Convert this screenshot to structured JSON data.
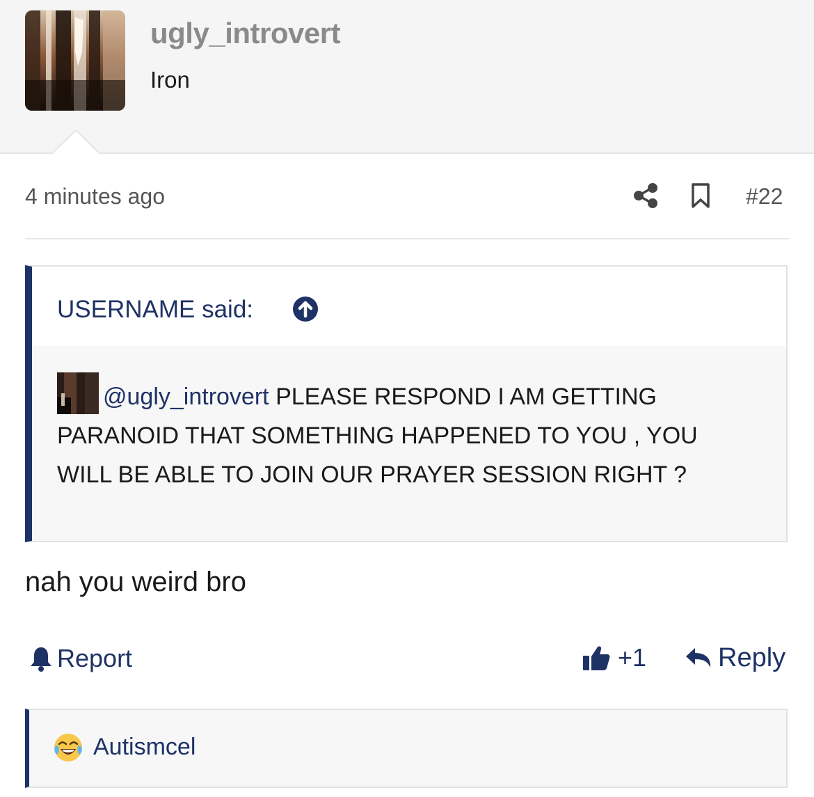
{
  "colors": {
    "accent": "#1f3266",
    "header_bg": "#f5f5f5",
    "quote_bg": "#f7f7f7",
    "username": "#8a8a8a",
    "meta_text": "#555555"
  },
  "author": {
    "username": "ugly_introvert",
    "title": "Iron",
    "avatar_icon": "avatar-image"
  },
  "post_meta": {
    "time": "4 minutes ago",
    "share_icon": "share-icon",
    "bookmark_icon": "bookmark-icon",
    "number": "#22"
  },
  "quote": {
    "author_label": "USERNAME said:",
    "jump_icon": "arrow-up-circle-icon",
    "mention": "@ugly_introvert",
    "text": " PLEASE RESPOND I AM GETTING PARANOID THAT SOMETHING HAPPENED TO YOU , YOU WILL BE ABLE TO JOIN OUR PRAYER SESSION RIGHT ?"
  },
  "body": "nah you weird bro",
  "actions": {
    "report_label": "Report",
    "report_icon": "bell-icon",
    "like_count": "+1",
    "like_icon": "thumbs-up-icon",
    "reply_label": "Reply",
    "reply_icon": "reply-arrow-icon"
  },
  "reactions": {
    "items": [
      {
        "user": "Autismcel",
        "emoji": "tears-of-joy-face-icon"
      }
    ]
  }
}
